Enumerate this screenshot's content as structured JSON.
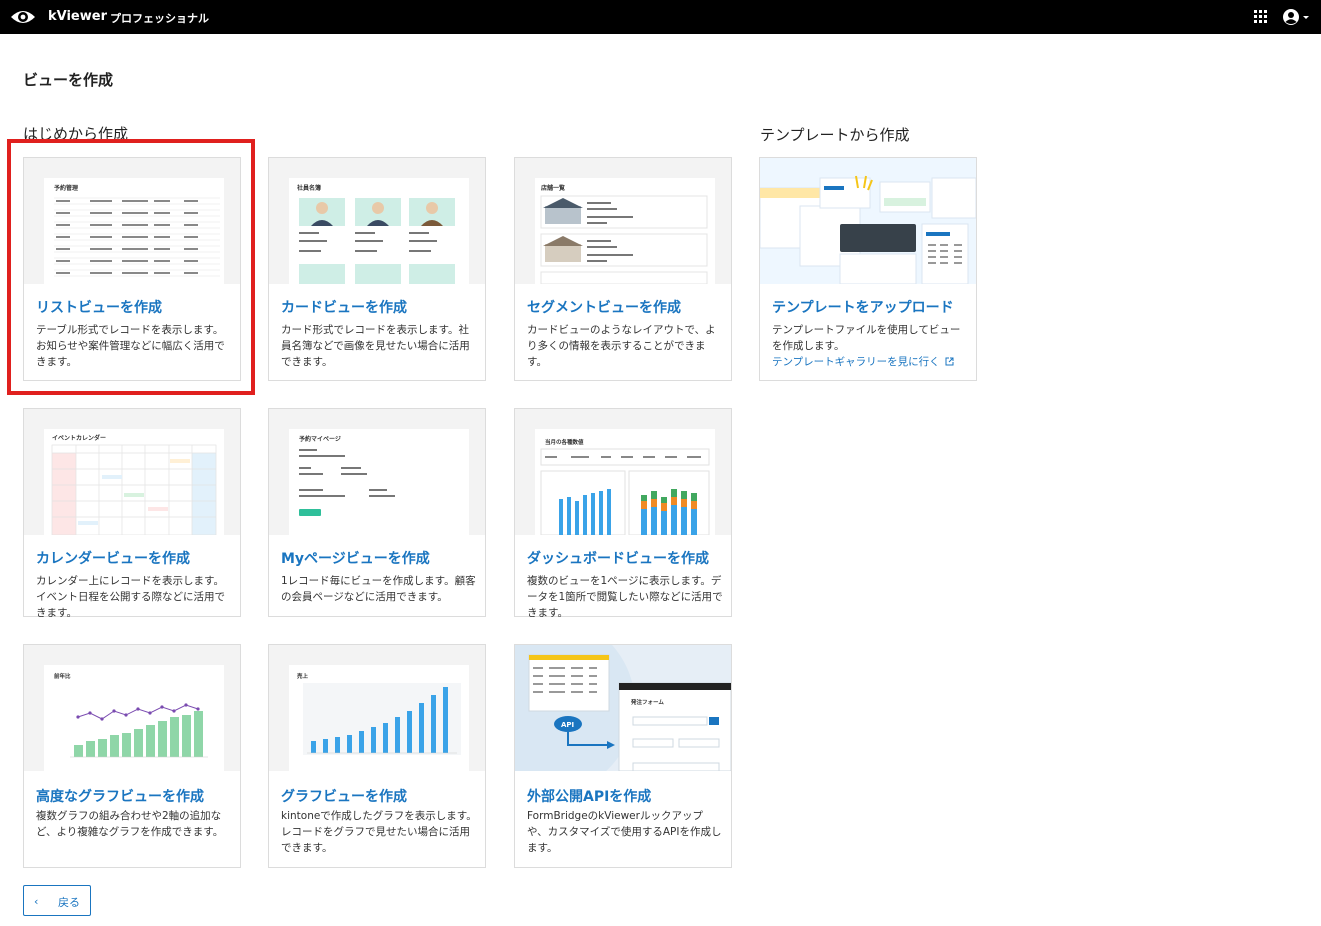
{
  "header": {
    "app_name": "kViewer",
    "plan": "プロフェッショナル",
    "icons": [
      "eye-logo-icon",
      "apps-grid-icon",
      "account-icon",
      "caret-down-icon"
    ]
  },
  "page": {
    "title": "ビューを作成",
    "sections": {
      "scratch": "はじめから作成",
      "template": "テンプレートから作成"
    }
  },
  "cards": [
    {
      "title": "リストビューを作成",
      "desc": "テーブル形式でレコードを表示します。お知らせや案件管理などに幅広く活用できます。",
      "thumb": "予約管理"
    },
    {
      "title": "カードビューを作成",
      "desc": "カード形式でレコードを表示します。社員名簿などで画像を見せたい場合に活用できます。",
      "thumb": "社員名簿"
    },
    {
      "title": "セグメントビューを作成",
      "desc": "カードビューのようなレイアウトで、より多くの情報を表示することができます。",
      "thumb": "店舗一覧"
    },
    {
      "title": "テンプレートをアップロード",
      "desc": "テンプレートファイルを使用してビューを作成します。",
      "link": "テンプレートギャラリーを見に行く"
    },
    {
      "title": "カレンダービューを作成",
      "desc": "カレンダー上にレコードを表示します。イベント日程を公開する際などに活用できます。",
      "thumb": "イベントカレンダー"
    },
    {
      "title": "Myページビューを作成",
      "desc": "1レコード毎にビューを作成します。顧客の会員ページなどに活用できます。",
      "thumb": "予約マイページ"
    },
    {
      "title": "ダッシュボードビューを作成",
      "desc": "複数のビューを1ページに表示します。データを1箇所で閲覧したい際などに活用できます。",
      "thumb": "当月の各種数値"
    },
    {
      "title": "高度なグラフビューを作成",
      "desc": "複数グラフの組み合わせや2軸の追加など、より複雑なグラフを作成できます。",
      "thumb": "前年比"
    },
    {
      "title": "グラフビューを作成",
      "desc": "kintoneで作成したグラフを表示します。レコードをグラフで見せたい場合に活用できます。",
      "thumb": "売上"
    },
    {
      "title": "外部公開APIを作成",
      "desc": "FormBridgeのkViewerルックアップや、カスタマイズで使用するAPIを作成します。",
      "thumb": "発注フォーム"
    }
  ],
  "back_button": {
    "label": "戻る"
  },
  "colors": {
    "topbar": "#000000",
    "accent": "#1a75c0",
    "selection": "#e0201e",
    "chart_blue": "#3aa3e8",
    "chart_green": "#8fd6a8",
    "chart_orange": "#f08a24",
    "chart_purple": "#7a4bb0"
  }
}
